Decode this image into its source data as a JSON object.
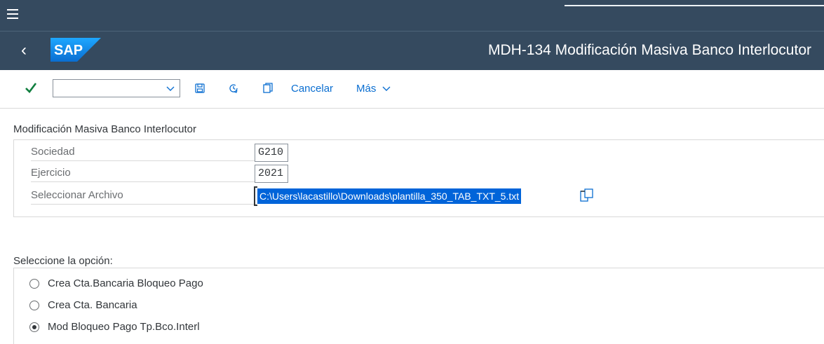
{
  "shell": {
    "app_title": "MDH-134 Modificación Masiva Banco Interlocutor",
    "logo_text": "SAP",
    "colors": {
      "shell_bg": "#354a5f",
      "link": "#0a6ed1",
      "selection": "#0064d9",
      "accept_green": "#107e3e"
    }
  },
  "toolbar": {
    "command_value": "",
    "cancel_label": "Cancelar",
    "more_label": "Más"
  },
  "form": {
    "section_title": "Modificación Masiva Banco Interlocutor",
    "fields": [
      {
        "label": "Sociedad",
        "value": "G210"
      },
      {
        "label": "Ejercicio",
        "value": "2021"
      },
      {
        "label": "Seleccionar Archivo",
        "value": "C:\\Users\\lacastillo\\Downloads\\plantilla_350_TAB_TXT_5.txt"
      }
    ]
  },
  "options": {
    "section_title": "Seleccione la opción:",
    "items": [
      {
        "label": "Crea Cta.Bancaria Bloqueo Pago",
        "selected": false
      },
      {
        "label": "Crea Cta. Bancaria",
        "selected": false
      },
      {
        "label": "Mod Bloqueo Pago Tp.Bco.Interl",
        "selected": true
      }
    ]
  }
}
